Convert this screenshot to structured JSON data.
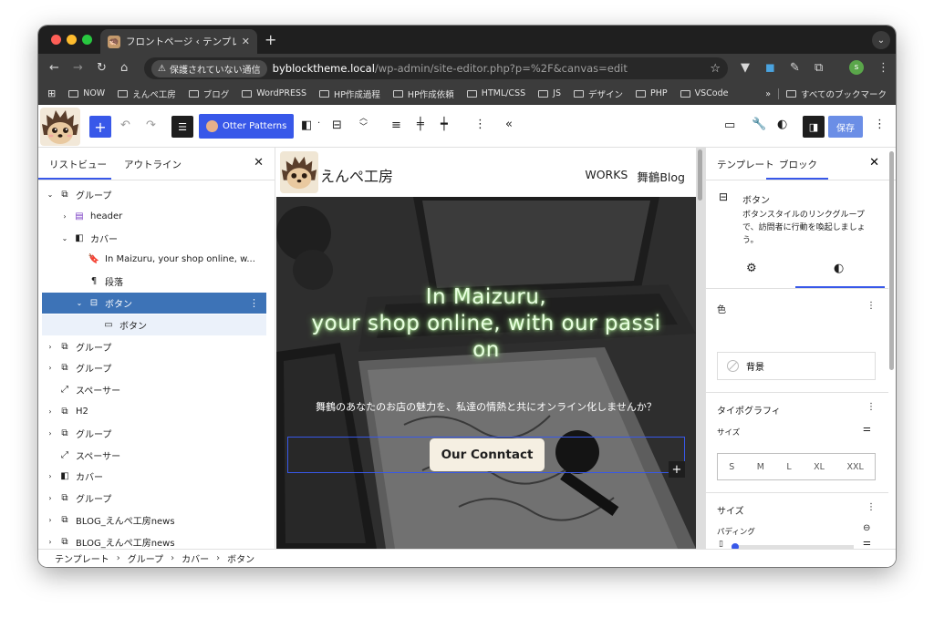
{
  "browser": {
    "tab_title": "フロントページ ‹ テンプレート ‹",
    "url_warning": "保護されていない通信",
    "url_host": "byblocktheme.local",
    "url_path": "/wp-admin/site-editor.php?p=%2F&canvas=edit",
    "profile_initial": "s",
    "bookmarks": [
      "NOW",
      "えんぺ工房",
      "ブログ",
      "WordPRESS",
      "HP作成過程",
      "HP作成依頼",
      "HTML/CSS",
      "JS",
      "デザイン",
      "PHP",
      "VSCode"
    ],
    "bookmarks_all": "すべてのブックマーク",
    "colors": {
      "close": "#fe5f57",
      "minimize": "#febc2e",
      "maximize": "#28c840"
    }
  },
  "editor": {
    "otter_label": "Otter Patterns",
    "save_label": "保存",
    "accent": "#3858e9"
  },
  "list_view": {
    "tab_list": "リストビュー",
    "tab_outline": "アウトライン",
    "items": [
      {
        "label": "グループ",
        "icon": "group-icon",
        "caret": "⌄",
        "level": 0
      },
      {
        "label": "header",
        "icon": "header-icon",
        "caret": "›",
        "level": 1
      },
      {
        "label": "カバー",
        "icon": "cover-icon",
        "caret": "⌄",
        "level": 1
      },
      {
        "label": "In Maizuru, your shop online, w...",
        "icon": "bookmark-icon",
        "caret": "",
        "level": 2
      },
      {
        "label": "段落",
        "icon": "paragraph-icon",
        "caret": "",
        "level": 2
      },
      {
        "label": "ボタン",
        "icon": "buttons-icon",
        "caret": "⌄",
        "level": 2,
        "selected": true
      },
      {
        "label": "ボタン",
        "icon": "button-icon",
        "caret": "",
        "level": 3,
        "sub": true
      },
      {
        "label": "グループ",
        "icon": "group-icon",
        "caret": "›",
        "level": 0
      },
      {
        "label": "グループ",
        "icon": "group-icon",
        "caret": "›",
        "level": 0
      },
      {
        "label": "スペーサー",
        "icon": "spacer-icon",
        "caret": "",
        "level": 0
      },
      {
        "label": "H2",
        "icon": "group-icon",
        "caret": "›",
        "level": 0
      },
      {
        "label": "グループ",
        "icon": "group-icon",
        "caret": "›",
        "level": 0
      },
      {
        "label": "スペーサー",
        "icon": "spacer-icon",
        "caret": "",
        "level": 0
      },
      {
        "label": "カバー",
        "icon": "cover-icon",
        "caret": "›",
        "level": 0
      },
      {
        "label": "グループ",
        "icon": "group-icon",
        "caret": "›",
        "level": 0
      },
      {
        "label": "BLOG_えんぺ工房news",
        "icon": "group-icon",
        "caret": "›",
        "level": 0
      },
      {
        "label": "BLOG_えんぺ工房news",
        "icon": "group-icon",
        "caret": "›",
        "level": 0
      }
    ]
  },
  "site": {
    "title": "えんぺ工房",
    "nav": [
      "WORKS",
      "舞鶴Blog"
    ],
    "cover_heading_lines": [
      "In Maizuru,",
      "your shop online, with our passi",
      "on"
    ],
    "cover_text": "舞鶴のあなたのお店の魅力を、私達の情熱と共にオンライン化しませんか？",
    "button_label": "Our Conntact"
  },
  "inspector": {
    "tab_template": "テンプレート",
    "tab_block": "ブロック",
    "block_name": "ボタン",
    "block_desc": "ボタンスタイルのリンクグループで、訪問者に行動を喚起しましょう。",
    "color_title": "色",
    "background_label": "背景",
    "typography_title": "タイポグラフィ",
    "size_label": "サイズ",
    "font_sizes": [
      "S",
      "M",
      "L",
      "XL",
      "XXL"
    ],
    "dimensions_title": "サイズ",
    "padding_label": "パディング"
  },
  "breadcrumb": [
    "テンプレート",
    "グループ",
    "カバー",
    "ボタン"
  ]
}
